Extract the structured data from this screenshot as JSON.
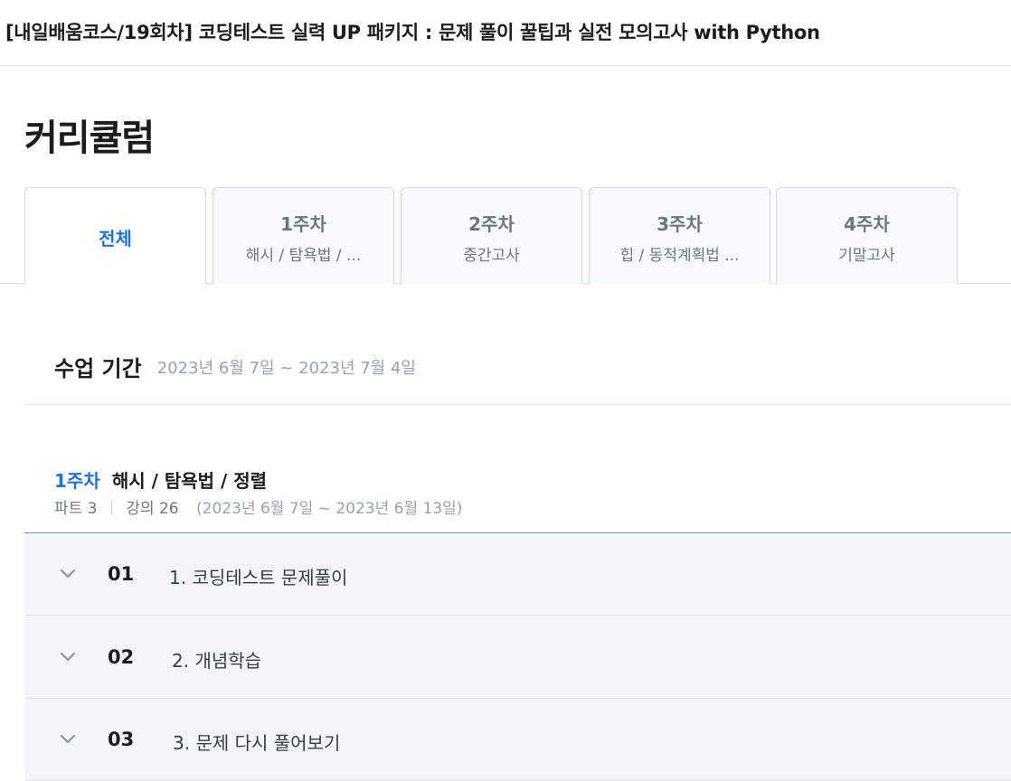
{
  "course": {
    "title": "[내일배움코스/19회차] 코딩테스트 실력 UP 패키지 : 문제 풀이 꿀팁과 실전 모의고사 with Python"
  },
  "section": {
    "title": "커리큘럼"
  },
  "tabs": [
    {
      "label": "전체",
      "active": true
    },
    {
      "week": "1주차",
      "subtitle": "해시 / 탐욕법 / ..."
    },
    {
      "week": "2주차",
      "subtitle": "중간고사"
    },
    {
      "week": "3주차",
      "subtitle": "힙 / 동적계획법 ..."
    },
    {
      "week": "4주차",
      "subtitle": "기말고사"
    }
  ],
  "period": {
    "label": "수업 기간",
    "value": "2023년 6월 7일 ~ 2023년 7월 4일"
  },
  "week1": {
    "label": "1주차",
    "topic": "해시 / 탐욕법 / 정렬",
    "parts": "파트 3",
    "lectures": "강의 26",
    "dates": "(2023년 6월 7일 ~ 2023년 6월 13일)",
    "lessons": [
      {
        "no": "01",
        "title": "1. 코딩테스트 문제풀이"
      },
      {
        "no": "02",
        "title": "2. 개념학습"
      },
      {
        "no": "03",
        "title": "3. 문제 다시 풀어보기"
      }
    ]
  },
  "colors": {
    "accent": "#1a73e8",
    "muted": "#98a2ad",
    "lesson_bg": "#f4f5f8"
  },
  "icons": {
    "lesson_toggle": "chevron-down-icon"
  }
}
